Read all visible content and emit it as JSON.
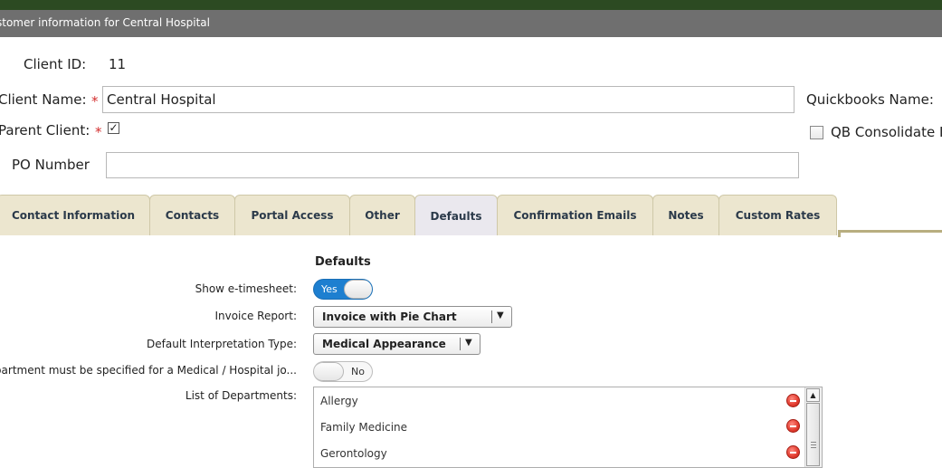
{
  "window": {
    "title": "stomer information for Central Hospital"
  },
  "header_fields": {
    "client_id_label": "Client ID:",
    "client_id_value": "11",
    "client_name_label": "Client Name:",
    "client_name_value": "Central Hospital",
    "parent_client_label": "Parent Client:",
    "parent_client_checked": "✓",
    "required_marker": "*",
    "po_number_label": "PO Number",
    "po_number_value": "",
    "quickbooks_name_label": "Quickbooks Name:",
    "qb_consolidate_label": "QB Consolidate I"
  },
  "tabs": [
    {
      "label": "Contact Information"
    },
    {
      "label": "Contacts"
    },
    {
      "label": "Portal Access"
    },
    {
      "label": "Other"
    },
    {
      "label": "Defaults",
      "active": true
    },
    {
      "label": "Confirmation Emails"
    },
    {
      "label": "Notes"
    },
    {
      "label": "Custom Rates"
    }
  ],
  "defaults": {
    "section_title": "Defaults",
    "show_etimesheet_label": "Show e-timesheet:",
    "show_etimesheet_value": "Yes",
    "invoice_report_label": "Invoice Report:",
    "invoice_report_value": "Invoice with Pie Chart",
    "default_interp_label": "Default Interpretation Type:",
    "default_interp_value": "Medical Appearance",
    "department_required_label": "Department must be specified for a Medical / Hospital jo...",
    "department_required_value": "No",
    "departments_label": "List of Departments:",
    "departments": [
      "Allergy",
      "Family Medicine",
      "Gerontology"
    ],
    "dropdown_arrow": "▼",
    "scroll_up_arrow": "▲"
  },
  "colors": {
    "topbar": "#2c4a22",
    "titlebar": "#6f6f6f",
    "tab_bg": "#ece6cf",
    "toggle_on": "#1d7fd0",
    "required": "#d32f2f"
  }
}
